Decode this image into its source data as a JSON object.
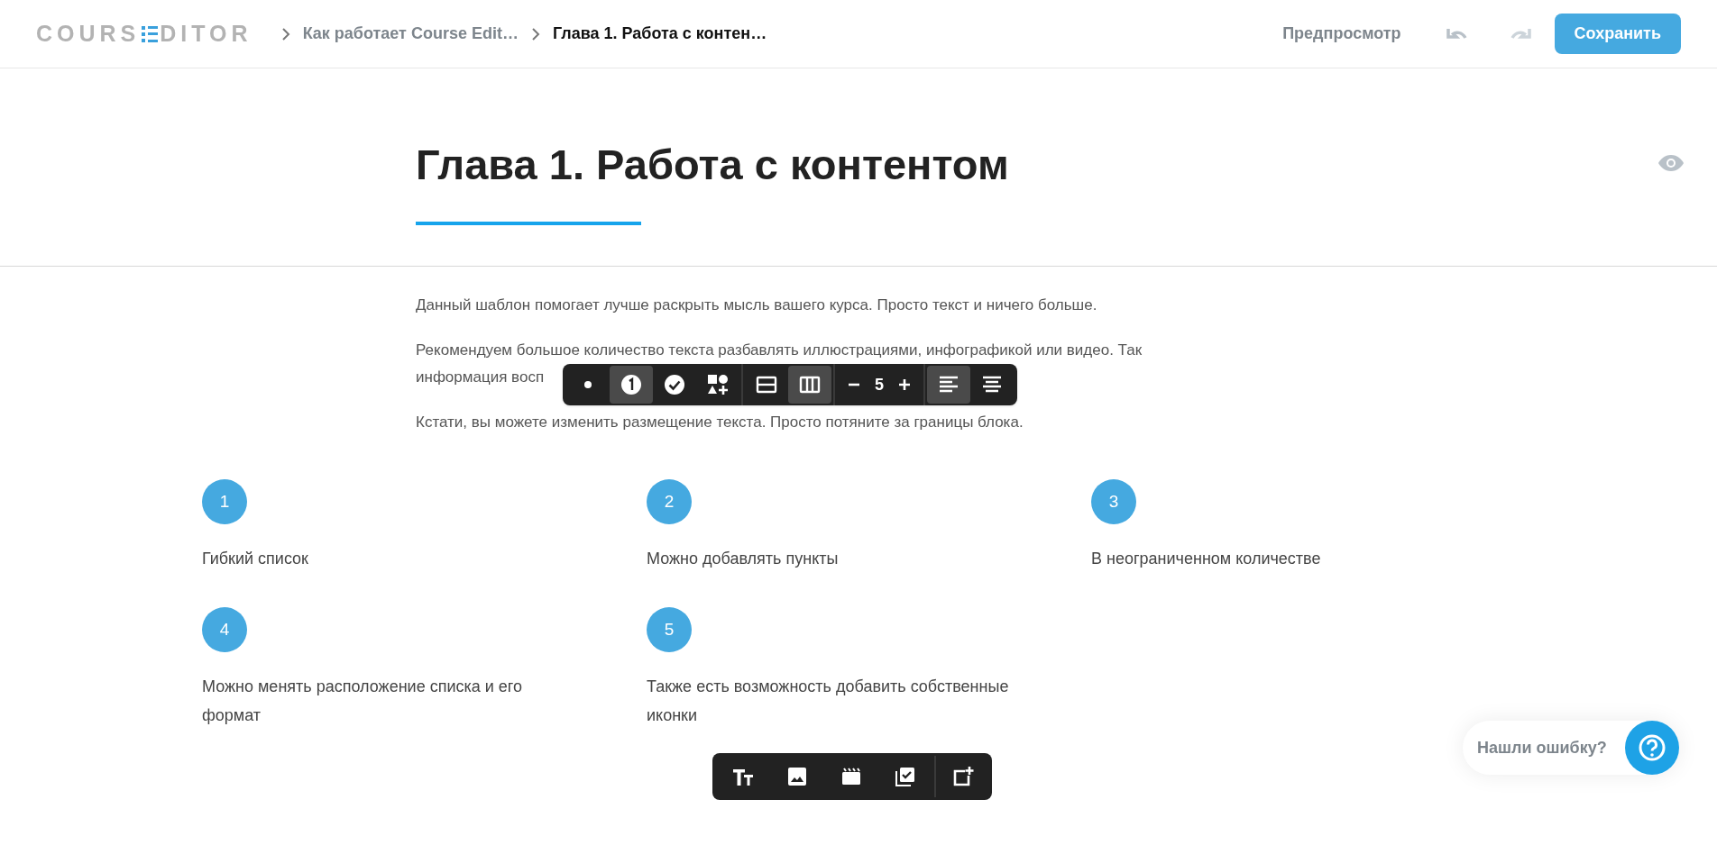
{
  "header": {
    "logo": [
      "COURS",
      "DITOR"
    ],
    "breadcrumbs": [
      "Как работает Course Edit…",
      "Глава 1. Работа с контен…"
    ],
    "preview": "Предпросмотр",
    "save": "Сохранить"
  },
  "chapter": {
    "title": "Глава 1. Работа с контентом"
  },
  "paragraphs": [
    {
      "lines": [
        "Данный шаблон помогает лучше раскрыть мысль вашего курса. Просто текст и ничего больше."
      ]
    },
    {
      "lines": [
        "Рекомендуем большое количество текста разбавлять иллюстрациями, инфографикой или видео. Так",
        "информация восп"
      ]
    },
    {
      "lines": [
        "Кстати, вы можете изменить размещение текста. Просто потяните за границы блока."
      ]
    }
  ],
  "list_toolbar": {
    "styles": [
      {
        "kind": "bullet",
        "selected": false
      },
      {
        "kind": "number",
        "selected": true
      },
      {
        "kind": "check",
        "selected": false
      },
      {
        "kind": "shapes",
        "selected": false
      }
    ],
    "layouts": [
      {
        "kind": "rows",
        "selected": false
      },
      {
        "kind": "columns",
        "selected": true
      }
    ],
    "count": "5",
    "alignments": [
      {
        "kind": "left",
        "selected": true
      },
      {
        "kind": "center",
        "selected": false
      }
    ]
  },
  "steps": [
    {
      "number": "1",
      "text": "Гибкий список"
    },
    {
      "number": "2",
      "text": "Можно добавлять пункты"
    },
    {
      "number": "3",
      "text": "В неограниченном количестве"
    },
    {
      "number": "4",
      "text": "Можно менять расположение списка и его формат"
    },
    {
      "number": "5",
      "text": "Также есть возможность добавить собственные иконки"
    }
  ],
  "help": {
    "label": "Нашли ошибку?"
  }
}
